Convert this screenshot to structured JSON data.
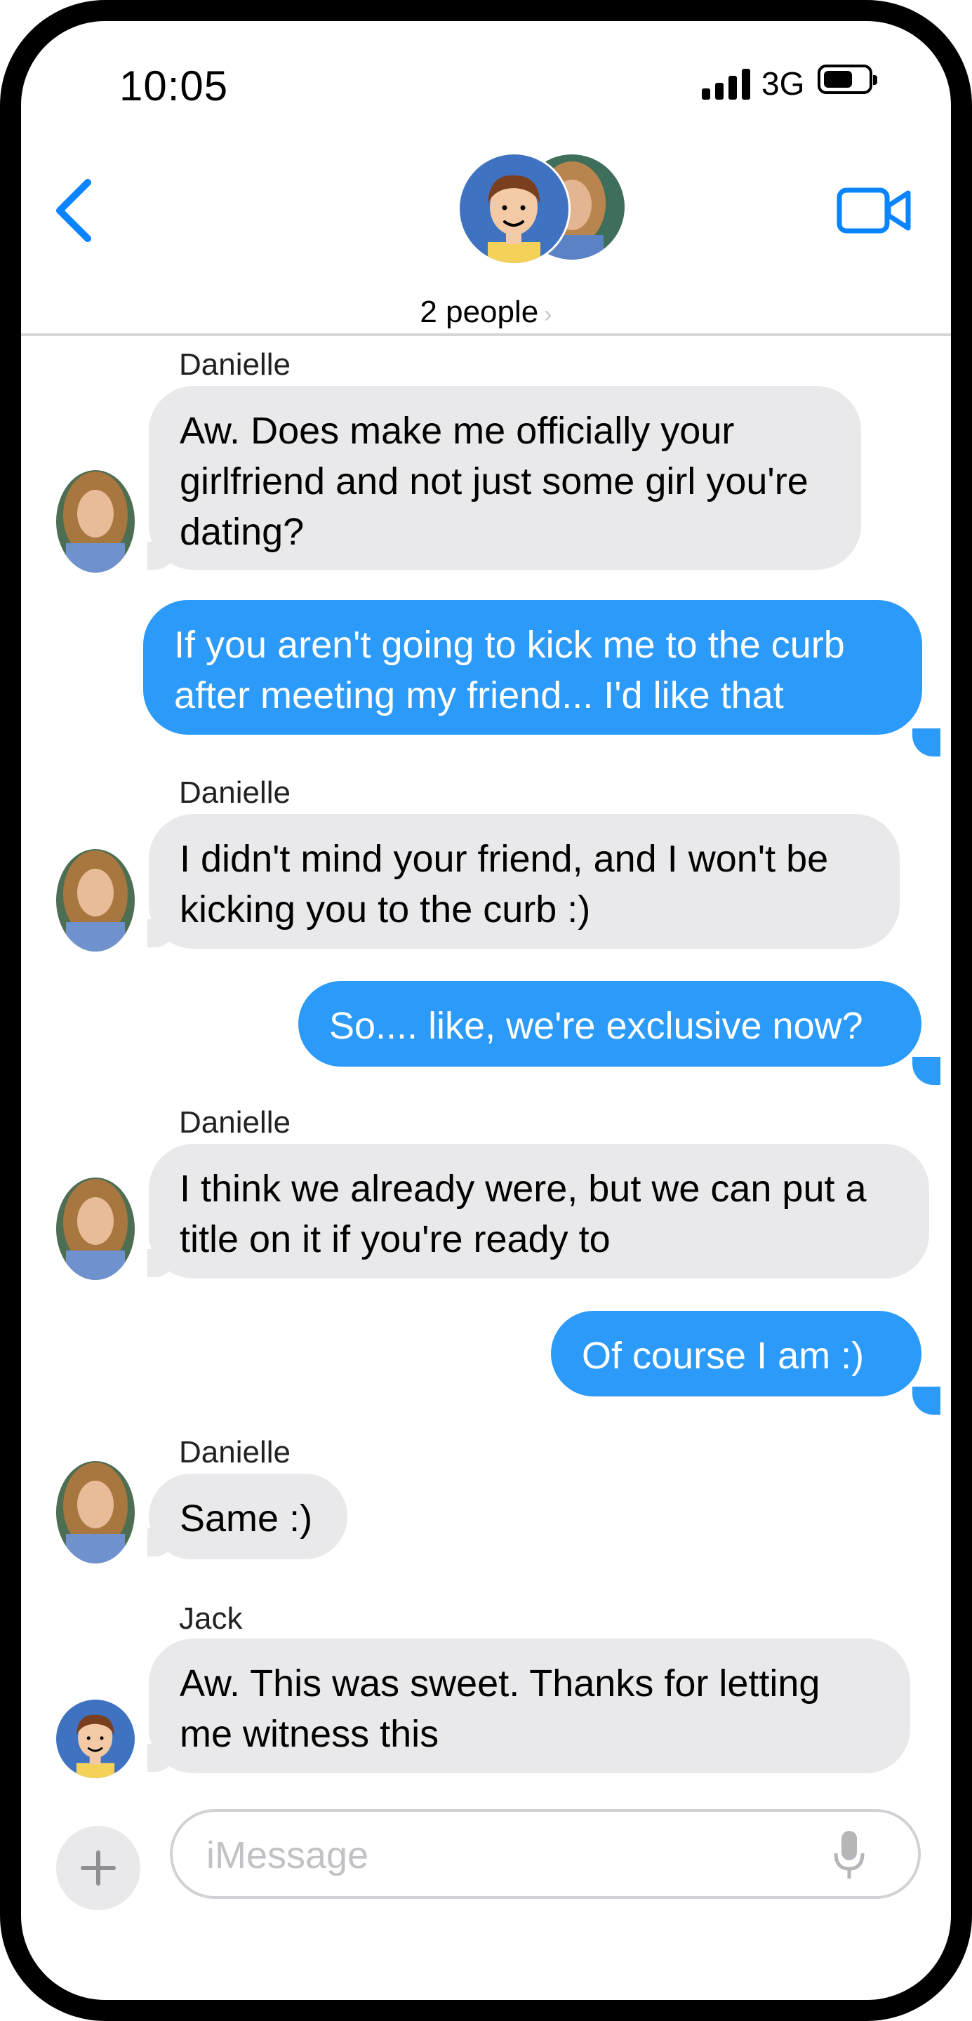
{
  "status_bar": {
    "time": "10:05",
    "network": "3G"
  },
  "header": {
    "people_label": "2 people",
    "chevron": "›"
  },
  "messages": [
    {
      "direction": "in",
      "sender": "Danielle",
      "text": "Aw.  Does make me officially your\ngirlfriend and not just some girl you're\ndating?"
    },
    {
      "direction": "out",
      "text": "If you aren't going to kick me to the curb\nafter meeting my friend... I'd like that"
    },
    {
      "direction": "in",
      "sender": "Danielle",
      "text": "I didn't mind your friend, and I won't be\nkicking you to the curb :)"
    },
    {
      "direction": "out",
      "text": "So.... like, we're exclusive now?"
    },
    {
      "direction": "in",
      "sender": "Danielle",
      "text": "I think we already were, but we can put a\ntitle on it if you're ready to"
    },
    {
      "direction": "out",
      "text": "Of course I am :)"
    },
    {
      "direction": "in",
      "sender": "Danielle",
      "text": "Same :)"
    },
    {
      "direction": "in",
      "sender": "Jack",
      "text": "Aw.  This was sweet.  Thanks for letting\nme witness this"
    }
  ],
  "composer": {
    "placeholder": "iMessage",
    "plus_symbol": "+"
  },
  "colors": {
    "outgoing_bubble": "#2c9af8",
    "incoming_bubble": "#e9e9eb",
    "accent": "#0a84ff"
  }
}
